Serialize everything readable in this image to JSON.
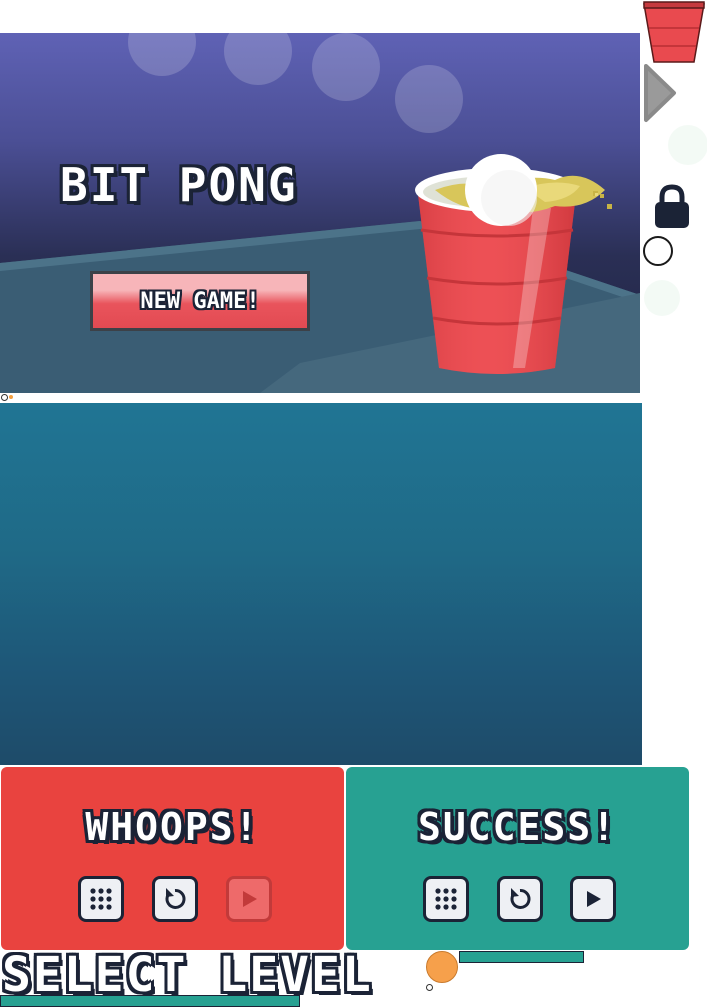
{
  "hero": {
    "title": "BIT PONG",
    "new_game_label": "NEW GAME!"
  },
  "results": {
    "whoops": {
      "title": "WHOOPS!",
      "buttons": [
        {
          "icon": "grid-icon",
          "enabled": true
        },
        {
          "icon": "replay-icon",
          "enabled": true
        },
        {
          "icon": "play-icon",
          "enabled": false
        }
      ]
    },
    "success": {
      "title": "SUCCESS!",
      "buttons": [
        {
          "icon": "grid-icon",
          "enabled": true
        },
        {
          "icon": "replay-icon",
          "enabled": true
        },
        {
          "icon": "play-icon",
          "enabled": true
        }
      ]
    }
  },
  "select_level": {
    "title": "SELECT LEVEL"
  },
  "rail": {
    "icons": [
      "red-cup-icon",
      "arrow-right-icon",
      "lock-icon",
      "ball-outline-icon"
    ]
  },
  "colors": {
    "whoops": "#e9433f",
    "success": "#27a192",
    "cup_red": "#e94a4f",
    "playfield": "#1f6a87",
    "ball_orange": "#f6a04b"
  }
}
